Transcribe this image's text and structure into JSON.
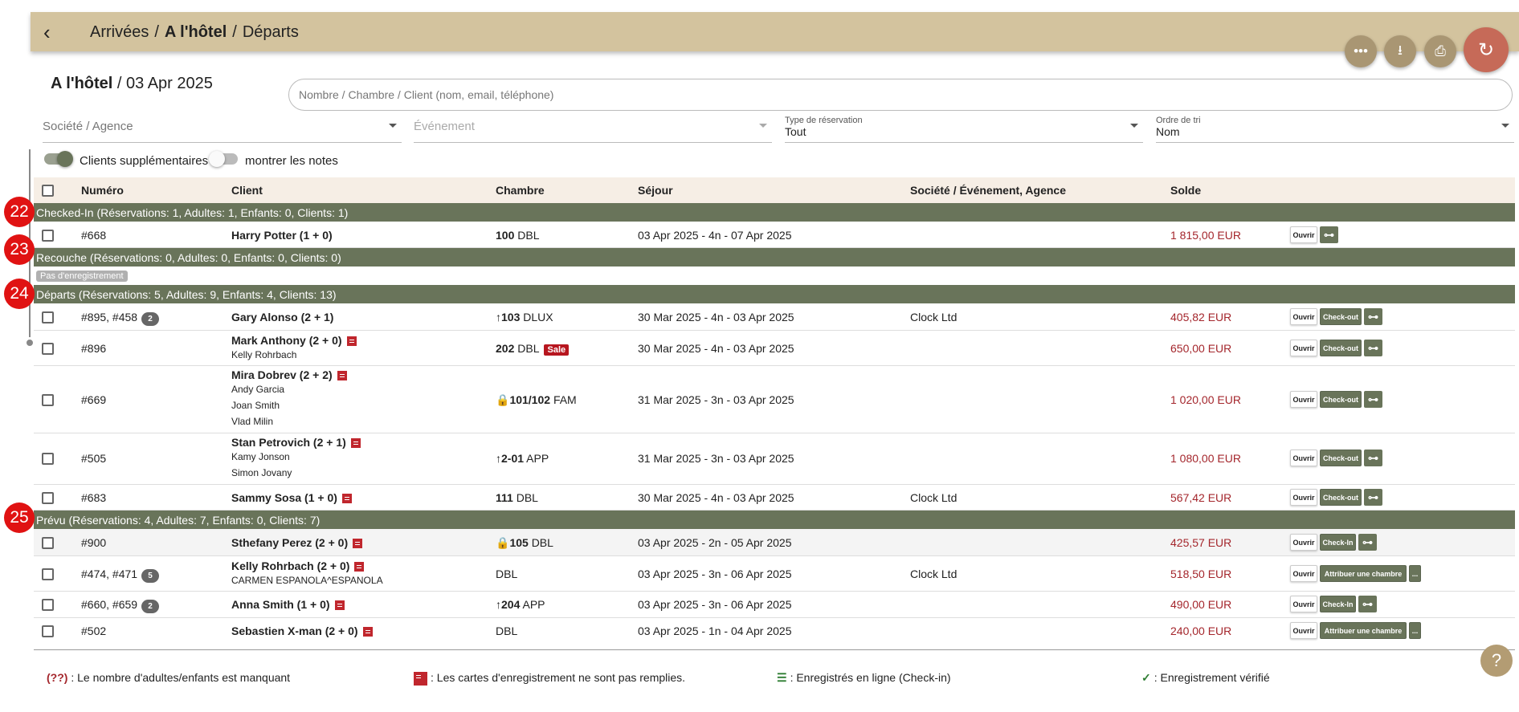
{
  "header": {
    "back_glyph": "‹",
    "crumb_arrivals": "Arrivées",
    "crumb_hotel": "A l'hôtel",
    "crumb_departures": "Départs"
  },
  "actions": {
    "more": "•••",
    "download": "⭳",
    "print": "⎙",
    "refresh": "↻"
  },
  "page": {
    "title_bold": "A l'hôtel",
    "title_date": "/ 03 Apr 2025"
  },
  "search": {
    "placeholder": "Nombre / Chambre / Client (nom, email, téléphone)"
  },
  "filters": {
    "company_placeholder": "Société / Agence",
    "event_placeholder": "Événement",
    "type_label": "Type de réservation",
    "type_value": "Tout",
    "sort_label": "Ordre de tri",
    "sort_value": "Nom"
  },
  "toggles": {
    "extra_clients": "Clients supplémentaires",
    "show_notes": "montrer les notes"
  },
  "columns": {
    "number": "Numéro",
    "client": "Client",
    "room": "Chambre",
    "stay": "Séjour",
    "company": "Société / Événement, Agence",
    "balance": "Solde"
  },
  "groups": {
    "g22": {
      "marker": "22",
      "label": "Checked-In (Réservations: 1, Adultes: 1, Enfants: 0, Clients: 1)"
    },
    "g23": {
      "marker": "23",
      "label": "Recouche (Réservations: 0, Adultes: 0, Enfants: 0, Clients: 0)",
      "empty": "Pas d'enregistrement"
    },
    "g24": {
      "marker": "24",
      "label": "Départs (Réservations: 5, Adultes: 9, Enfants: 4, Clients: 13)"
    },
    "g25": {
      "marker": "25",
      "label": "Prévu (Réservations: 4, Adultes: 7, Enfants: 0, Clients: 7)"
    }
  },
  "rows": {
    "r1": {
      "num": "#668",
      "client": "Harry Potter (1 + 0)",
      "room_no": "100",
      "room_type": "DBL",
      "stay": "03 Apr 2025 - 4n - 07 Apr 2025",
      "company": "",
      "balance": "1 815,00 EUR"
    },
    "r2": {
      "num": "#895, #458",
      "badge": "2",
      "client": "Gary Alonso (2 + 1)",
      "room_no": "103",
      "room_type": "DLUX",
      "stay": "30 Mar 2025 - 4n - 03 Apr 2025",
      "company": "Clock Ltd",
      "balance": "405,82 EUR"
    },
    "r3": {
      "num": "#896",
      "client": "Mark Anthony (2 + 0)",
      "g1": "Kelly Rohrbach",
      "room_no": "202",
      "room_type": "DBL",
      "sale": "Sale",
      "stay": "30 Mar 2025 - 4n - 03 Apr 2025",
      "company": "",
      "balance": "650,00 EUR"
    },
    "r4": {
      "num": "#669",
      "client": "Mira Dobrev (2 + 2)",
      "g1": "Andy Garcia",
      "g2": "Joan Smith",
      "g3": "Vlad Milin",
      "room_no": "101/102",
      "room_type": "FAM",
      "stay": "31 Mar 2025 - 3n - 03 Apr 2025",
      "company": "",
      "balance": "1 020,00 EUR"
    },
    "r5": {
      "num": "#505",
      "client": "Stan Petrovich (2 + 1)",
      "g1": "Kamy Jonson",
      "g2": "Simon Jovany",
      "room_no": "2-01",
      "room_type": "APP",
      "stay": "31 Mar 2025 - 3n - 03 Apr 2025",
      "company": "",
      "balance": "1 080,00 EUR"
    },
    "r6": {
      "num": "#683",
      "client": "Sammy Sosa (1 + 0)",
      "room_no": "111",
      "room_type": "DBL",
      "stay": "30 Mar 2025 - 4n - 03 Apr 2025",
      "company": "Clock Ltd",
      "balance": "567,42 EUR"
    },
    "r7": {
      "num": "#900",
      "client": "Sthefany Perez (2 + 0)",
      "room_no": "105",
      "room_type": "DBL",
      "stay": "03 Apr 2025 - 2n - 05 Apr 2025",
      "company": "",
      "balance": "425,57 EUR"
    },
    "r8": {
      "num": "#474, #471",
      "badge": "5",
      "client": "Kelly Rohrbach (2 + 0)",
      "g1": "CARMEN ESPANOLA^ESPANOLA",
      "room_no": "",
      "room_type": "DBL",
      "stay": "03 Apr 2025 - 3n - 06 Apr 2025",
      "company": "Clock Ltd",
      "balance": "518,50 EUR"
    },
    "r9": {
      "num": "#660, #659",
      "badge": "2",
      "client": "Anna Smith (1 + 0)",
      "room_no": "204",
      "room_type": "APP",
      "stay": "03 Apr 2025 - 3n - 06 Apr 2025",
      "company": "",
      "balance": "490,00 EUR"
    },
    "r10": {
      "num": "#502",
      "client": "Sebastien X-man (2 + 0)",
      "room_no": "",
      "room_type": "DBL",
      "stay": "03 Apr 2025 - 1n - 04 Apr 2025",
      "company": "",
      "balance": "240,00 EUR"
    }
  },
  "buttons": {
    "open": "Ouvrir",
    "checkout": "Check-out",
    "checkin": "Check-In",
    "assign": "Attribuer une chambre",
    "more": "...",
    "key": "⊶"
  },
  "legend": {
    "missing_code": "(??)",
    "missing": ": Le nombre d'adultes/enfants est manquant",
    "cards": ": Les cartes d'enregistrement ne sont pas remplies.",
    "online": ": Enregistrés en ligne (Check-in)",
    "verified": ": Enregistrement vérifié"
  },
  "help": "?",
  "colors": {
    "header_bg": "#d3c39e",
    "group_bg": "#69745a",
    "balance": "#a4262c",
    "marker": "#e01212",
    "refresh": "#c66a58"
  }
}
